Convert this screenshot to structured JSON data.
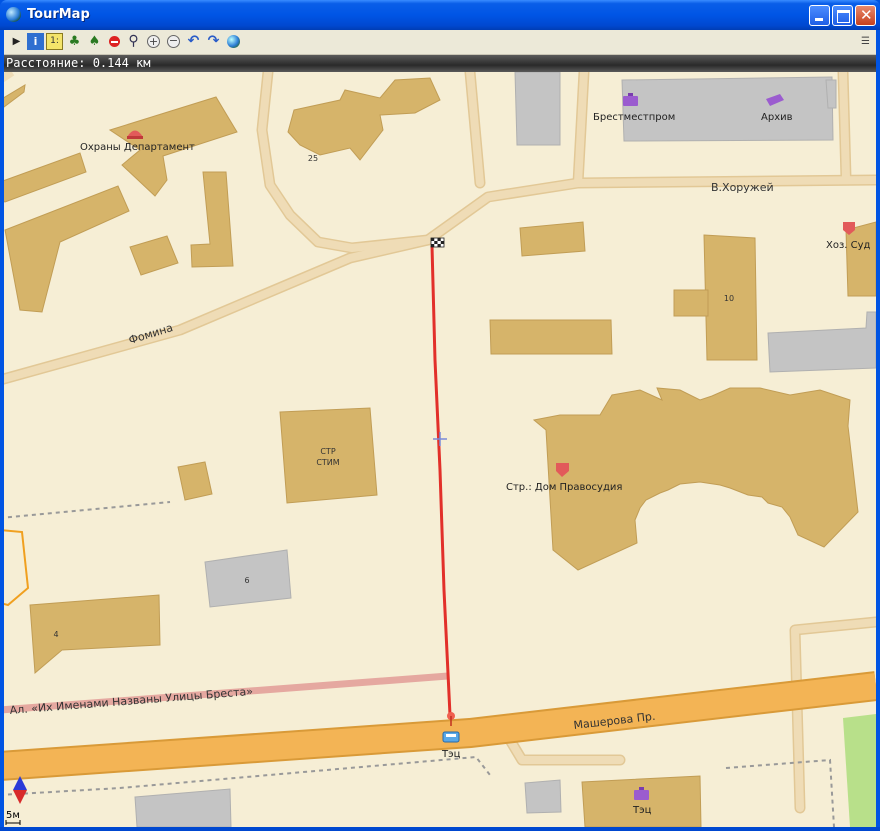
{
  "window": {
    "title": "TourMap",
    "controls": [
      "minimize",
      "maximize",
      "close"
    ]
  },
  "toolbar": {
    "tools": [
      {
        "name": "pointer-icon",
        "glyph": "▶"
      },
      {
        "name": "info-icon",
        "glyph": "i"
      },
      {
        "name": "ruler-icon",
        "glyph": "1:"
      },
      {
        "name": "tree-icon",
        "glyph": "♣"
      },
      {
        "name": "traffic-light-icon",
        "glyph": "●"
      },
      {
        "name": "no-entry-icon",
        "glyph": "−"
      },
      {
        "name": "magnifier-icon",
        "glyph": "⌕"
      },
      {
        "name": "zoom-in-icon",
        "glyph": "+"
      },
      {
        "name": "zoom-out-icon",
        "glyph": "−"
      },
      {
        "name": "undo-icon",
        "glyph": "↶"
      },
      {
        "name": "redo-icon",
        "glyph": "↷"
      },
      {
        "name": "globe-icon",
        "glyph": "●"
      }
    ],
    "menu_icon": "list-icon"
  },
  "status": {
    "distance": "Расстояние: 0.144 км"
  },
  "map": {
    "labels": {
      "okhrany": "Охраны Департамент",
      "brestmestprom": "Брестместпром",
      "arkhiv": "Архив",
      "khoruzhey": "В.Хоружей",
      "khoz_sud": "Хоз. Суд",
      "fomina": "Фомина",
      "num_25": "25",
      "num_10": "10",
      "str_stim_1": "СТР",
      "str_stim_2": "СТИМ",
      "dom_pravosudiya": "Стр.: Дом Правосудия",
      "num_6": "6",
      "num_4": "4",
      "alley": "Ал. «Их Именами Названы Улицы Бреста»",
      "masherova": "Машерова Пр.",
      "tets_stop": "Тэц",
      "tets_bottom": "Тэц"
    },
    "scale": "5м",
    "colors": {
      "background": "#f6eed5",
      "building": "#d6b46a",
      "building_gray": "#c4c4c4",
      "road_minor": "#ebd5a6",
      "road_major": "#f3b455",
      "route": "#e2302a",
      "park": "#b8e08a"
    }
  }
}
